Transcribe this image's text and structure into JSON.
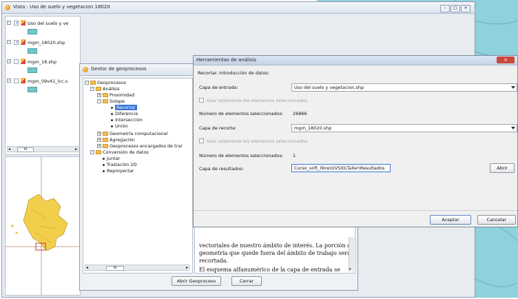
{
  "map_window": {
    "title": "Vista : Uso de suelo y vegetacion 18020",
    "layers": [
      {
        "name": "Uso del suelo y ve",
        "checked": true
      },
      {
        "name": "mgm_18020.shp",
        "checked": true
      },
      {
        "name": "mgm_18.shp",
        "checked": false
      },
      {
        "name": "mgm_09v41_lcc.s",
        "checked": false
      }
    ],
    "scroll_label": "III",
    "controls": [
      "min",
      "max",
      "close"
    ]
  },
  "geoprocess_window": {
    "title": "Gestor de geoprocesos",
    "tree": [
      {
        "label": "Geoprocesos",
        "kind": "folder"
      },
      {
        "label": "Análisis",
        "kind": "folder"
      },
      {
        "label": "Proximidad",
        "kind": "folder"
      },
      {
        "label": "Solape",
        "kind": "folder"
      },
      {
        "label": "Recortar",
        "kind": "leaf",
        "selected": true
      },
      {
        "label": "Diferencia",
        "kind": "leaf"
      },
      {
        "label": "Intersección",
        "kind": "leaf"
      },
      {
        "label": "Unión",
        "kind": "leaf"
      },
      {
        "label": "Geometría computacional",
        "kind": "folder"
      },
      {
        "label": "Agregación",
        "kind": "folder"
      },
      {
        "label": "Geoprocesos encargados de trar",
        "kind": "folder"
      },
      {
        "label": "Conversión de datos",
        "kind": "folder"
      },
      {
        "label": "Juntar",
        "kind": "leaf"
      },
      {
        "label": "Traslación 2D",
        "kind": "leaf"
      },
      {
        "label": "Reproyectar",
        "kind": "leaf"
      }
    ],
    "description_lines": [
      "vectoriales de nuestro ámbito de interés. La porción de",
      "geometría que quede fuera del ámbito de trabajo será",
      "recortada.",
      "El esquema alfanumérico de la capa de entrada se"
    ],
    "scroll_label": "III",
    "buttons": {
      "open": "Abrir Geoproceso",
      "close": "Cerrar"
    }
  },
  "analysis_dialog": {
    "title": "Herramientas de análisis",
    "heading": "Recortar. Introducción de datos:",
    "input_layer_label": "Capa de entrada:",
    "input_layer_value": "Uso del suelo y vegetacion.shp",
    "use_selected_label": "Usar solamente los elementos seleccionados",
    "count_label": "Número de elementos seleccionados:",
    "input_count": "26866",
    "clip_layer_label": "Capa de recorte:",
    "clip_layer_value": "mgm_18020.shp",
    "clip_count": "1",
    "output_label": "Capa de resultados:",
    "output_value": "Curso_soft_libre\\GVSIG\\Taller\\Resultados",
    "open_button": "Abrir",
    "accept_button": "Aceptar",
    "cancel_button": "Cancelar",
    "close_icon": "close-icon"
  },
  "colors": {
    "map_water": "#8fd1dc",
    "map_region": "#f2cf4a",
    "selection": "#3874d8",
    "close_red": "#c9483b"
  }
}
